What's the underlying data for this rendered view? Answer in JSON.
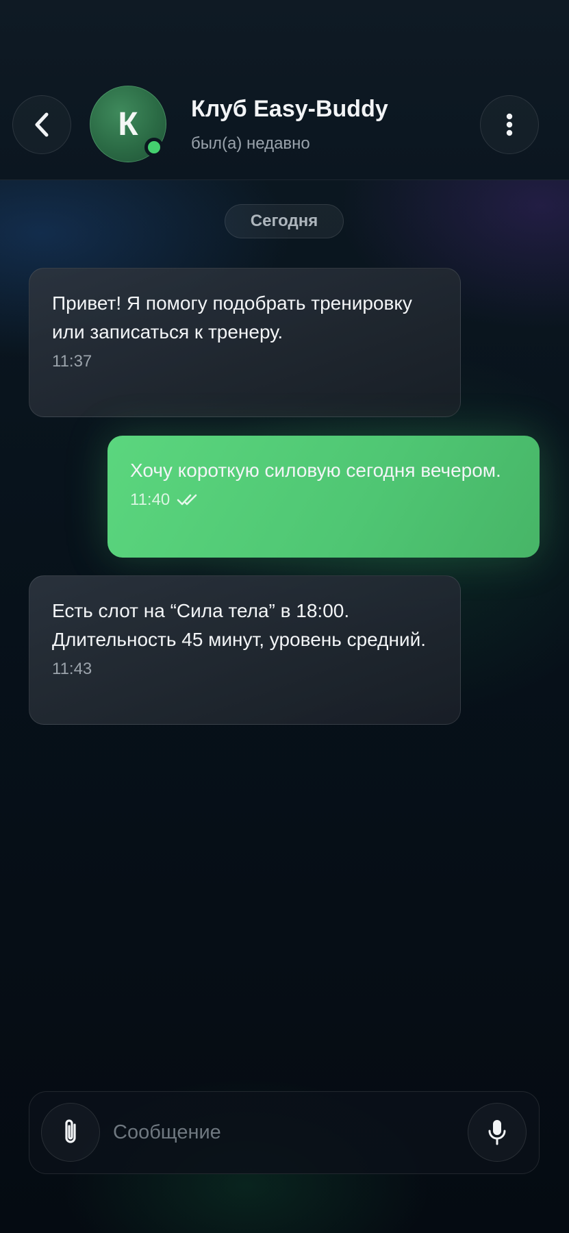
{
  "header": {
    "contact_name": "Клуб Easy-Buddy",
    "status": "был(а) недавно",
    "avatar_letter": "К",
    "online": true,
    "back_icon": "chevron-left-icon",
    "menu_icon": "more-vertical-icon"
  },
  "chat": {
    "date_label": "Сегодня",
    "messages": [
      {
        "direction": "incoming",
        "text": "Привет! Я помогу подобрать тренировку или записаться к тренеру.",
        "time": "11:37"
      },
      {
        "direction": "outgoing",
        "text": "Хочу короткую силовую сегодня вечером.",
        "time": "11:40",
        "read": true
      },
      {
        "direction": "incoming",
        "text": "Есть слот на “Сила тела” в 18:00. Длительность 45 минут, уровень средний.",
        "time": "11:43"
      }
    ]
  },
  "composer": {
    "placeholder": "Сообщение",
    "value": "",
    "attach_icon": "paperclip-icon",
    "mic_icon": "microphone-icon"
  },
  "colors": {
    "accent_green": "#4fc673",
    "online_dot": "#44d06f",
    "background": "#050b12"
  }
}
